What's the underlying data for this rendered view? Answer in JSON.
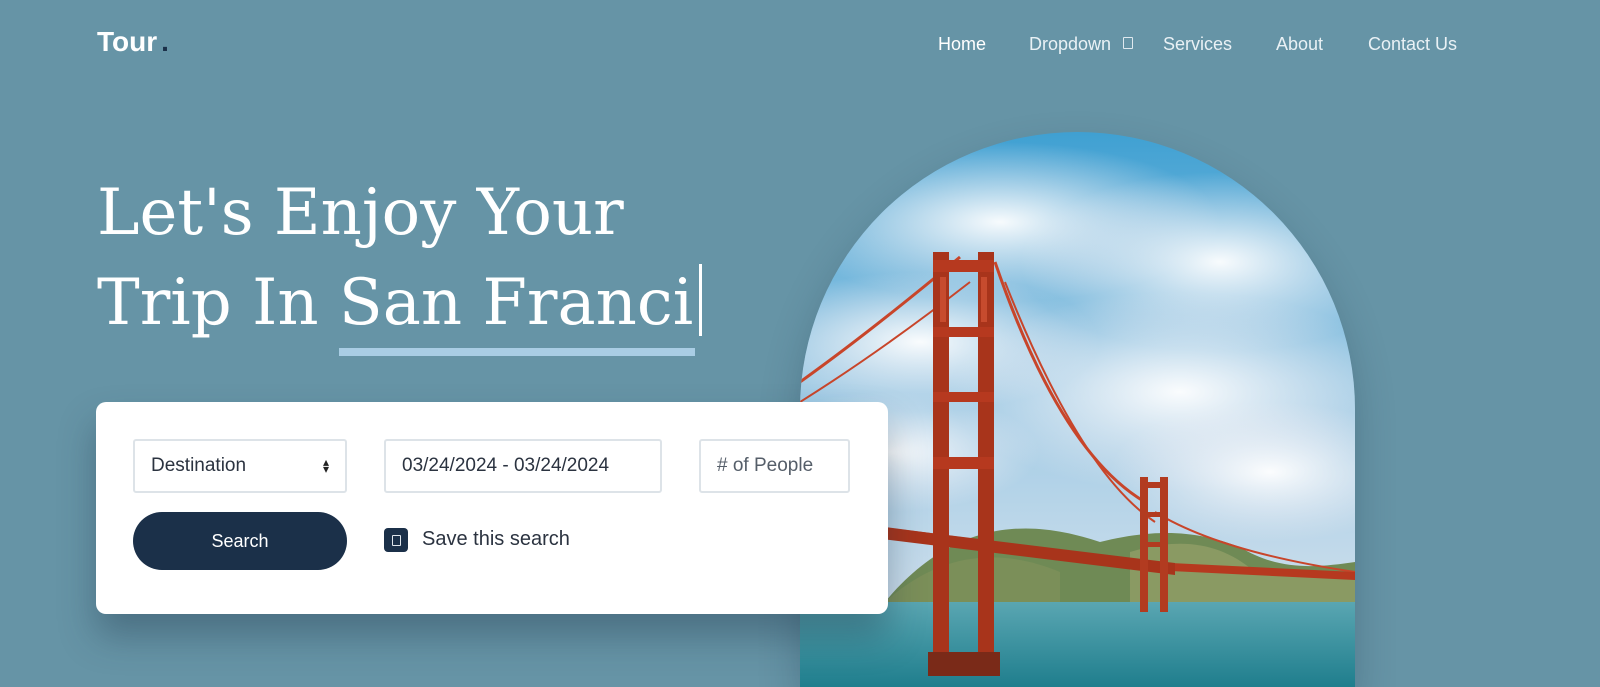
{
  "brand": {
    "name": "Tour",
    "dot": "."
  },
  "nav": {
    "items": [
      {
        "label": "Home",
        "active": true
      },
      {
        "label": "Dropdown",
        "has_dropdown": true
      },
      {
        "label": "Services"
      },
      {
        "label": "About"
      },
      {
        "label": "Contact Us"
      }
    ]
  },
  "hero": {
    "line1": "Let's Enjoy Your",
    "line2_prefix": "Trip In",
    "typed_text": "San Franci"
  },
  "search_form": {
    "destination_value": "Destination",
    "date_range_value": "03/24/2024 - 03/24/2024",
    "people_placeholder": "# of People",
    "search_button_label": "Search",
    "save_search_label": "Save this search",
    "save_search_checked": true
  },
  "hero_image": {
    "subject": "golden-gate-bridge-photo"
  },
  "colors": {
    "background": "#6694a6",
    "primary_dark": "#1b3049",
    "underline_accent": "#a9cde4",
    "card": "#ffffff"
  }
}
